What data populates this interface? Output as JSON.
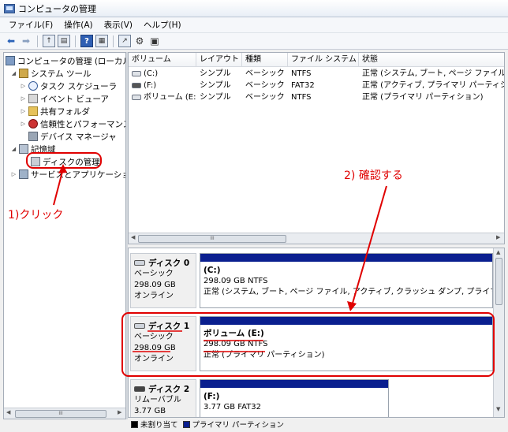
{
  "window": {
    "title": "コンピュータの管理"
  },
  "menu": [
    "ファイル(F)",
    "操作(A)",
    "表示(V)",
    "ヘルプ(H)"
  ],
  "toolbar": {
    "icons": [
      "back-arrow-icon",
      "forward-arrow-icon",
      "up-folder-icon",
      "show-hide-tree-icon",
      "help-icon",
      "properties-icon",
      "export-icon",
      "settings-icon"
    ]
  },
  "tree": {
    "root": "コンピュータの管理 (ローカル)",
    "system_tools": "システム ツール",
    "task_scheduler": "タスク スケジューラ",
    "event_viewer": "イベント ビューア",
    "shared_folders": "共有フォルダ",
    "reliability": "信頼性とパフォーマンス",
    "device_manager": "デバイス マネージャ",
    "storage": "記憶域",
    "disk_management": "ディスクの管理",
    "services": "サービスとアプリケーション"
  },
  "volumes": {
    "headers": [
      "ボリューム",
      "レイアウト",
      "種類",
      "ファイル システム",
      "状態"
    ],
    "rows": [
      [
        "(C:)",
        "シンプル",
        "ベーシック",
        "NTFS",
        "正常 (システム, ブート, ページ ファイル"
      ],
      [
        "(F:)",
        "シンプル",
        "ベーシック",
        "FAT32",
        "正常 (アクティブ, プライマリ パーティション)"
      ],
      [
        "ボリューム (E:)",
        "シンプル",
        "ベーシック",
        "NTFS",
        "正常 (プライマリ パーティション)"
      ]
    ]
  },
  "disks": [
    {
      "name": "ディスク 0",
      "type": "ベーシック",
      "size": "298.09 GB",
      "status": "オンライン",
      "vol_name": "(C:)",
      "vol_size": "298.09 GB NTFS",
      "vol_status": "正常 (システム, ブート, ページ ファイル, アクティブ, クラッシュ ダンプ, プライマ"
    },
    {
      "name": "ディスク 1",
      "type": "ベーシック",
      "size": "298.09 GB",
      "status": "オンライン",
      "vol_name": "ボリューム (E:)",
      "vol_size": "298.09 GB NTFS",
      "vol_status": "正常 (プライマリ パーティション)"
    },
    {
      "name": "ディスク 2",
      "type": "リムーバブル",
      "size": "3.77 GB",
      "status": "",
      "vol_name": "(F:)",
      "vol_size": "3.77 GB FAT32",
      "vol_status": ""
    }
  ],
  "legend": {
    "unallocated": "未割り当て",
    "primary": "プライマリ パーティション",
    "unallocated_color": "#000000",
    "primary_color": "#0a1f8f"
  },
  "annotations": {
    "click": "1)クリック",
    "confirm": "2) 確認する",
    "color": "#e00000"
  }
}
